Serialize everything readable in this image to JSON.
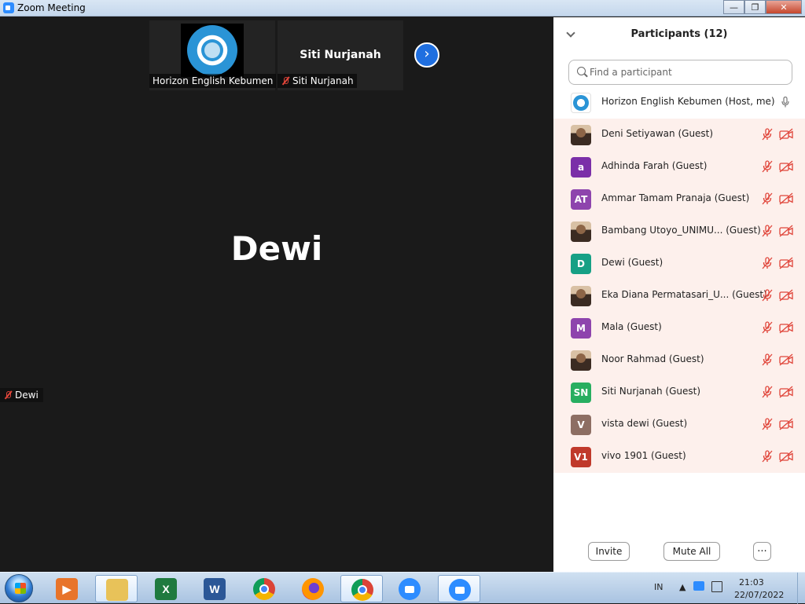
{
  "window": {
    "title": "Zoom Meeting"
  },
  "window_controls": {
    "minimize": "—",
    "restore": "❐",
    "close": "✕"
  },
  "video": {
    "thumbnails": [
      {
        "name": "Horizon English Kebumen",
        "muted": false,
        "has_logo": true
      },
      {
        "name": "Siti Nurjanah",
        "center_name": "Siti Nurjanah",
        "muted": true
      }
    ],
    "next_page_icon": "chevron-right-icon",
    "active_speaker": {
      "display_name": "Dewi",
      "label": "Dewi",
      "muted": true
    }
  },
  "participants_panel": {
    "title": "Participants (12)",
    "search_placeholder": "Find a participant",
    "host": {
      "name": "Horizon English Kebumen (Host, me)",
      "avatar": "logo"
    },
    "guests": [
      {
        "name": "Deni Setiyawan (Guest)",
        "avatar_type": "photo",
        "initials": "",
        "color": "#6b6b6b"
      },
      {
        "name": "Adhinda Farah (Guest)",
        "avatar_type": "initials",
        "initials": "a",
        "color": "#7b2fa8"
      },
      {
        "name": "Ammar Tamam Pranaja (Guest)",
        "avatar_type": "initials",
        "initials": "AT",
        "color": "#8e44ad"
      },
      {
        "name": "Bambang Utoyo_UNIMU... (Guest)",
        "avatar_type": "photo",
        "initials": "",
        "color": "#c0392b"
      },
      {
        "name": "Dewi (Guest)",
        "avatar_type": "initials",
        "initials": "D",
        "color": "#16a085"
      },
      {
        "name": "Eka Diana Permatasari_U... (Guest)",
        "avatar_type": "photo",
        "initials": "",
        "color": "#e8d8c8"
      },
      {
        "name": "Mala (Guest)",
        "avatar_type": "initials",
        "initials": "M",
        "color": "#8e44ad"
      },
      {
        "name": "Noor Rahmad (Guest)",
        "avatar_type": "photo",
        "initials": "",
        "color": "#5a5a5a"
      },
      {
        "name": "Siti Nurjanah (Guest)",
        "avatar_type": "initials",
        "initials": "SN",
        "color": "#27ae60"
      },
      {
        "name": "vista dewi (Guest)",
        "avatar_type": "initials",
        "initials": "V",
        "color": "#8d6e63"
      },
      {
        "name": "vivo 1901 (Guest)",
        "avatar_type": "initials",
        "initials": "V1",
        "color": "#c0392b"
      }
    ],
    "footer": {
      "invite": "Invite",
      "mute_all": "Mute All",
      "more": "..."
    }
  },
  "taskbar": {
    "apps": [
      {
        "name": "media-player",
        "glyph": "▶",
        "color": "#e8742a",
        "active": false
      },
      {
        "name": "file-explorer",
        "glyph": "",
        "color": "#e8c259",
        "active": true
      },
      {
        "name": "excel",
        "glyph": "X",
        "color": "#1f7a3f",
        "active": false
      },
      {
        "name": "word",
        "glyph": "W",
        "color": "#2b5797",
        "active": false
      },
      {
        "name": "chrome",
        "glyph": "",
        "color": "#db4437",
        "active": false
      },
      {
        "name": "firefox",
        "glyph": "",
        "color": "#e66000",
        "active": false
      },
      {
        "name": "chrome-2",
        "glyph": "",
        "color": "#db4437",
        "active": true
      },
      {
        "name": "zoom",
        "glyph": "",
        "color": "#2d8cff",
        "active": false
      },
      {
        "name": "zoom-2",
        "glyph": "",
        "color": "#2d8cff",
        "active": true
      }
    ],
    "language": "IN",
    "time": "21:03",
    "date": "22/07/2022"
  }
}
